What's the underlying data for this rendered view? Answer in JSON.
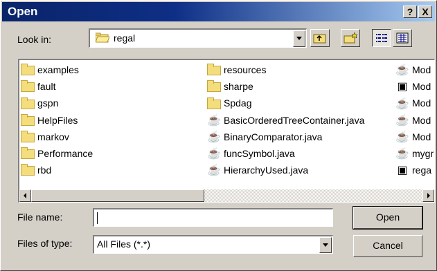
{
  "dialog": {
    "title": "Open"
  },
  "titlebar_buttons": {
    "help": "?",
    "close": "X"
  },
  "look_in": {
    "label": "Look in:",
    "value": "regal",
    "icon": "folder-open-icon"
  },
  "toolbar": {
    "icons": [
      "up-one-level-icon",
      "create-new-folder-icon",
      "list-view-icon",
      "details-view-icon"
    ]
  },
  "files": {
    "col1": [
      "examples",
      "fault",
      "gspn",
      "HelpFiles",
      "markov",
      "Performance",
      "rbd"
    ],
    "col2": [
      "resources",
      "sharpe",
      "Spdag",
      "BasicOrderedTreeContainer.java",
      "BinaryComparator.java",
      "funcSymbol.java",
      "HierarchyUsed.java"
    ],
    "col3": [
      "Mod",
      "Mod",
      "Mod",
      "Mod",
      "Mod",
      "mygr",
      "rega"
    ]
  },
  "file_name": {
    "label": "File name:",
    "value": ""
  },
  "file_type": {
    "label": "Files of type:",
    "value": "All Files (*.*)"
  },
  "buttons": {
    "open": "Open",
    "cancel": "Cancel"
  }
}
